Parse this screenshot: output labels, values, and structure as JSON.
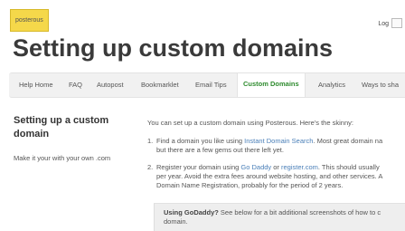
{
  "header": {
    "logo_text": "posterous",
    "login_label": "Log"
  },
  "page": {
    "title": "Setting up custom domains"
  },
  "nav": {
    "items": [
      {
        "label": "Help Home"
      },
      {
        "label": "FAQ"
      },
      {
        "label": "Autopost"
      },
      {
        "label": "Bookmarklet"
      },
      {
        "label": "Email Tips"
      },
      {
        "label": "Custom Domains",
        "active": true
      },
      {
        "label": "Analytics"
      },
      {
        "label": "Ways to sha"
      }
    ]
  },
  "sidebar": {
    "title": "Setting up a custom domain",
    "subtitle": "Make it your with your own .com"
  },
  "content": {
    "intro": "You can set up a custom domain using Posterous. Here's the skinny:",
    "steps": [
      {
        "num": "1.",
        "line1_pre": "Find a domain you like using ",
        "line1_link": "Instant Domain Search",
        "line1_post": ". Most great domain na",
        "line2": "but there are a few gems out there left yet."
      },
      {
        "num": "2.",
        "line1_pre": "Register your domain using ",
        "line1_link": "Go Daddy",
        "line1_mid": " or ",
        "line1_link2": "register.com",
        "line1_post": ". This should usually",
        "line2": "per year. Avoid the extra fees around website hosting, and other services. A",
        "line3": "Domain Name Registration, probably for the period of 2 years."
      }
    ],
    "callout": {
      "bold": "Using GoDaddy?",
      "text": " See below for a bit additional screenshots of how to c",
      "line2": "domain."
    }
  }
}
